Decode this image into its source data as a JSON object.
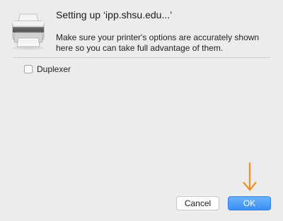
{
  "dialog": {
    "title": "Setting up ‘ipp.shsu.edu...’",
    "message": "Make sure your printer's options are accurately shown here so you can take full advantage of them."
  },
  "options": [
    {
      "label": "Duplexer",
      "checked": false
    }
  ],
  "buttons": {
    "cancel_label": "Cancel",
    "ok_label": "OK"
  },
  "icons": {
    "printer": "printer-icon",
    "annotation": "down-arrow-icon"
  },
  "colors": {
    "accent": "#3a8ef6",
    "annotation_arrow": "#f0901e"
  }
}
